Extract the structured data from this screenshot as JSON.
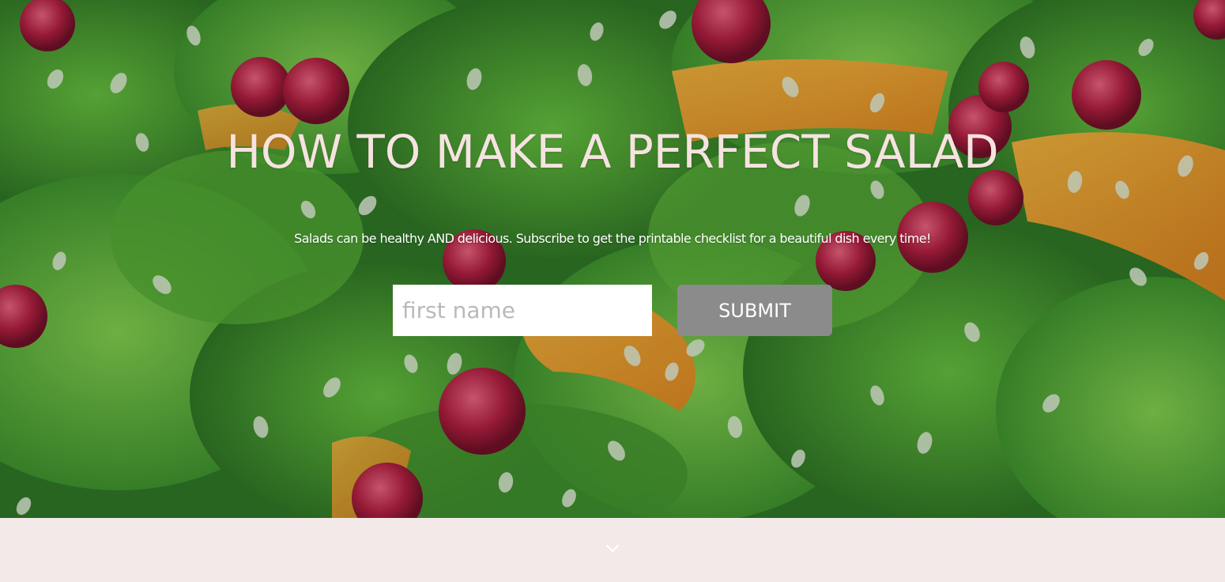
{
  "hero": {
    "title": "HOW TO MAKE A PERFECT SALAD",
    "subtitle": "Salads can be healthy AND delicious. Subscribe to get the printable checklist for a beautiful dish every time!"
  },
  "form": {
    "first_name_placeholder": "first name",
    "first_name_value": "",
    "submit_label": "SUBMIT"
  },
  "scroll_indicator": {
    "icon": "chevron-down-icon"
  },
  "colors": {
    "title": "#f6e3e1",
    "button": "#8b8b8b",
    "band": "#f4e9e9"
  }
}
